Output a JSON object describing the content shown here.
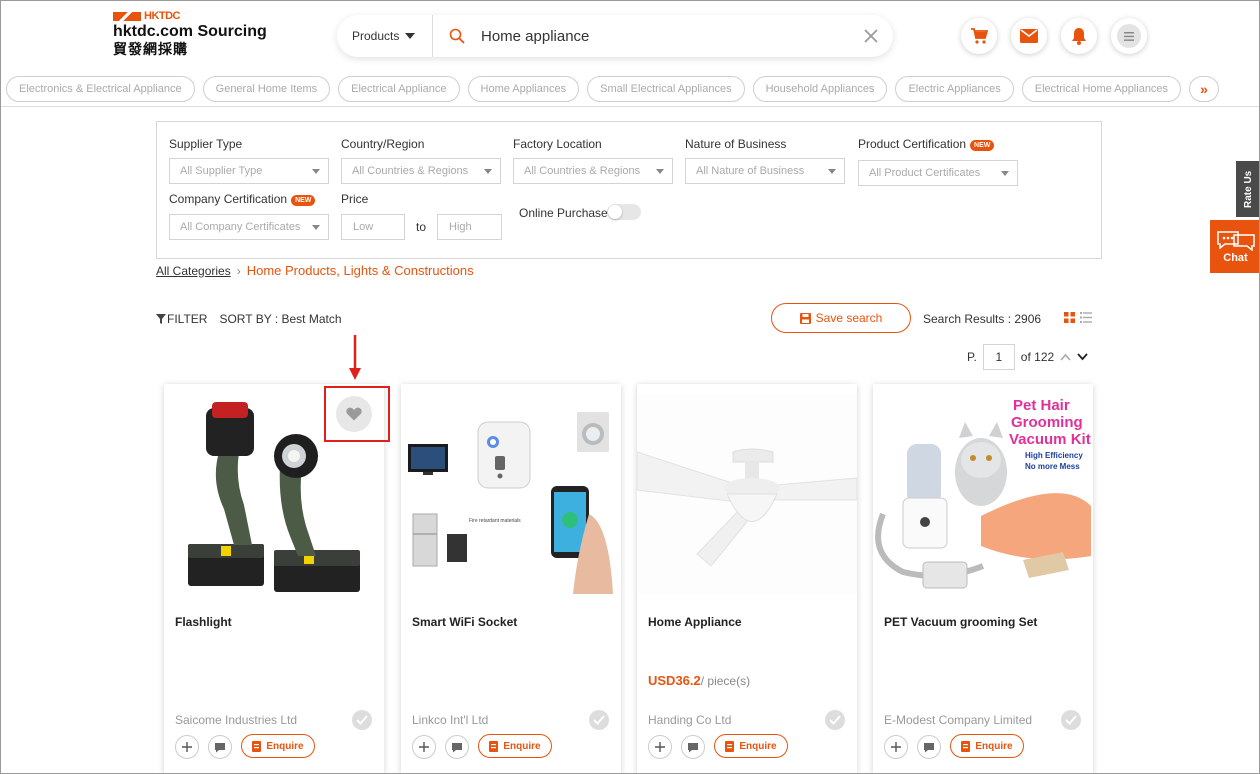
{
  "header": {
    "brandmark": "HKTDC",
    "site_name": "hktdc.com Sourcing",
    "site_name_cn": "貿發網採購",
    "search_type": "Products",
    "search_value": "Home appliance"
  },
  "categories": [
    "Electronics & Electrical Appliance",
    "General Home Items",
    "Electrical Appliance",
    "Home Appliances",
    "Small Electrical Appliances",
    "Household Appliances",
    "Electric Appliances",
    "Electrical Home Appliances"
  ],
  "filters": {
    "supplier_type": {
      "label": "Supplier Type",
      "value": "All Supplier Type"
    },
    "country": {
      "label": "Country/Region",
      "value": "All Countries & Regions"
    },
    "factory": {
      "label": "Factory Location",
      "value": "All Countries & Regions"
    },
    "nature": {
      "label": "Nature of Business",
      "value": "All Nature of Business"
    },
    "product_cert": {
      "label": "Product Certification",
      "value": "All Product Certificates"
    },
    "company_cert": {
      "label": "Company Certification",
      "value": "All Company Certificates"
    },
    "price": {
      "label": "Price",
      "low": "Low",
      "to": "to",
      "high": "High"
    },
    "online_purchase": {
      "label": "Online Purchase",
      "on": false
    },
    "new_badge": "NEW"
  },
  "breadcrumb": {
    "all": "All Categories",
    "current": "Home Products, Lights & Constructions"
  },
  "toolbar": {
    "filter": "FILTER",
    "sort": "SORT BY : Best Match",
    "save_search": "Save search",
    "results": "Search Results : 2906"
  },
  "pager": {
    "label": "P.",
    "page": "1",
    "of": "of 122"
  },
  "products": [
    {
      "title": "Flashlight",
      "price": "",
      "unit": "",
      "supplier": "Saicome Industries Ltd"
    },
    {
      "title": "Smart WiFi Socket",
      "price": "",
      "unit": "",
      "supplier": "Linkco Int'l Ltd",
      "img_caption": "Fire retardant materials"
    },
    {
      "title": "Home Appliance",
      "price": "USD36.2",
      "unit": "/ piece(s)",
      "supplier": "Handing Co Ltd"
    },
    {
      "title": "PET Vacuum grooming Set",
      "price": "",
      "unit": "",
      "supplier": "E-Modest Company Limited",
      "img_headline": "Pet Hair Grooming Vacuum Kit",
      "img_sub1": "High Efficiency",
      "img_sub2": "No more Mess"
    }
  ],
  "enquire_label": "Enquire",
  "side": {
    "rate_us": "Rate Us",
    "chat": "Chat"
  },
  "colors": {
    "accent": "#e8530e",
    "highlight": "#e0201b"
  }
}
